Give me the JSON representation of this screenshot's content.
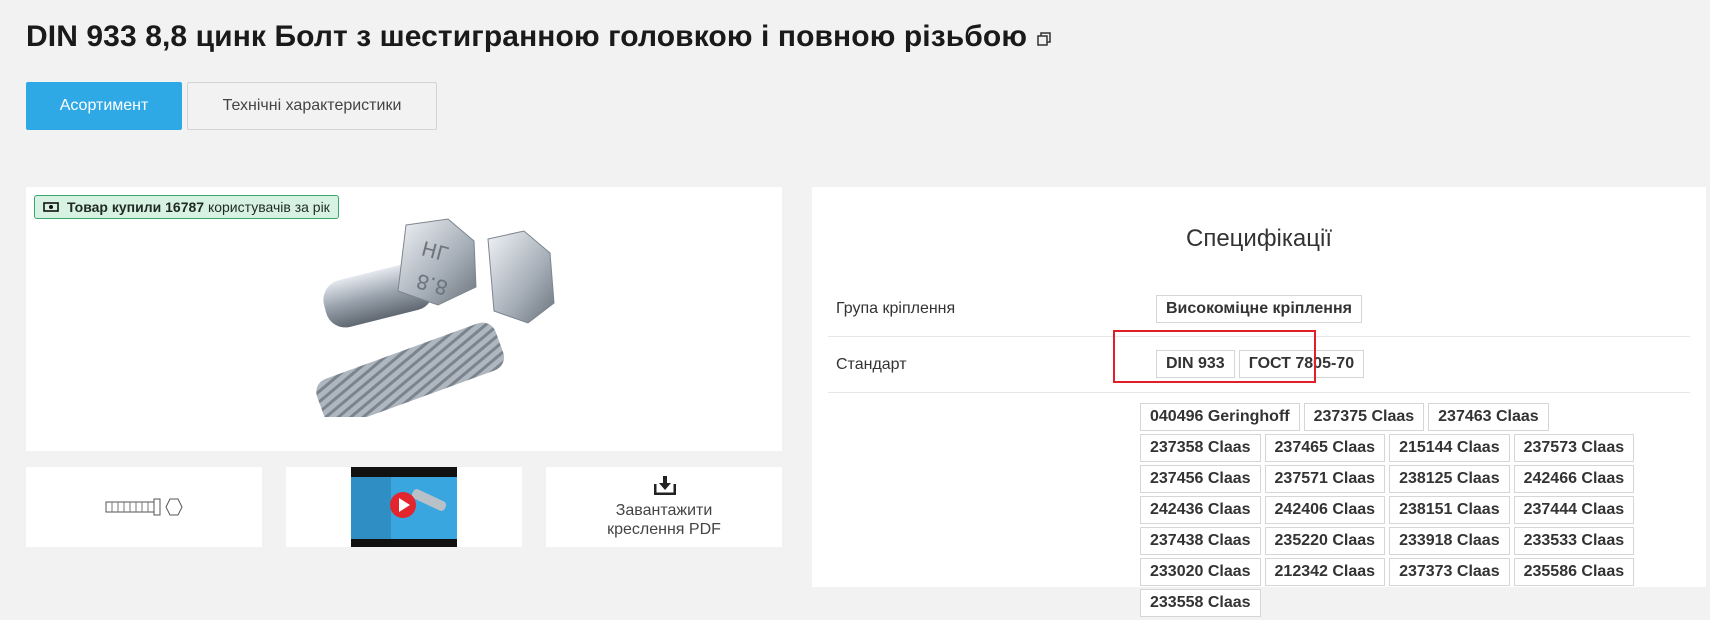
{
  "product": {
    "title": "DIN 933 8,8 цинк Болт з шестигранною головкою і повною різьбою"
  },
  "tabs": [
    {
      "label": "Асортимент",
      "active": true
    },
    {
      "label": "Технічні характеристики",
      "active": false
    }
  ],
  "badge": {
    "prefix": "Товар купили",
    "count": "16787",
    "suffix": "користувачів за рік",
    "border_color": "#37a86b",
    "bg_color": "#d8f2e2"
  },
  "thumbnails": {
    "pdf_label_line1": "Завантажити",
    "pdf_label_line2": "креслення PDF"
  },
  "spec": {
    "title": "Специфікації",
    "rows": [
      {
        "label": "Група кріплення",
        "values": [
          "Високоміцне кріплення"
        ]
      },
      {
        "label": "Стандарт",
        "values": [
          "DIN 933",
          "ГОСТ 7805-70"
        ]
      }
    ],
    "analogs": [
      "040496 Geringhoff",
      "237375 Claas",
      "237463 Claas",
      "237358 Claas",
      "237465 Claas",
      "215144 Claas",
      "237573 Claas",
      "237456 Claas",
      "237571 Claas",
      "238125 Claas",
      "242466 Claas",
      "242436 Claas",
      "242406 Claas",
      "238151 Claas",
      "237444 Claas",
      "237438 Claas",
      "235220 Claas",
      "233918 Claas",
      "233533 Claas",
      "233020 Claas",
      "212342 Claas",
      "237373 Claas",
      "235586 Claas",
      "233558 Claas"
    ]
  },
  "colors": {
    "accent": "#2fa8e6",
    "highlight": "#e01f26"
  }
}
